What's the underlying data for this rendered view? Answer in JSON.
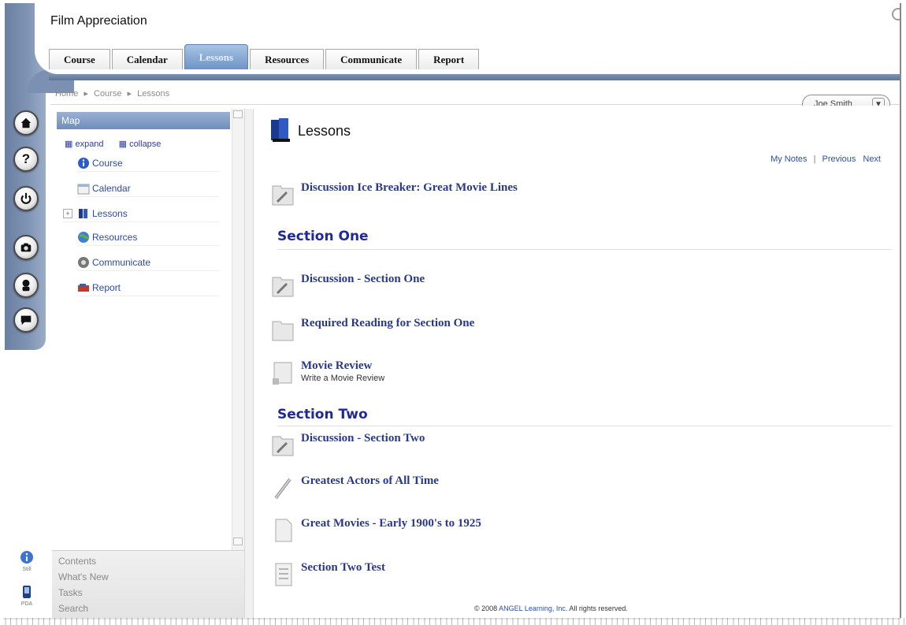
{
  "app": {
    "title": "Film Appreciation"
  },
  "tabs": [
    {
      "label": "Course",
      "active": false
    },
    {
      "label": "Calendar",
      "active": false
    },
    {
      "label": "Lessons",
      "active": true
    },
    {
      "label": "Resources",
      "active": false
    },
    {
      "label": "Communicate",
      "active": false
    },
    {
      "label": "Report",
      "active": false
    }
  ],
  "breadcrumb": [
    "Home",
    "Course",
    "Lessons"
  ],
  "breadcrumb_separator": "▸",
  "user_menu": {
    "label": "Joe Smith",
    "arrow": "▼"
  },
  "rail_icons": [
    "home-icon",
    "help-icon",
    "power-icon",
    "camera-icon",
    "profile-icon",
    "chat-icon"
  ],
  "rail_glyphs": {
    "help": "?"
  },
  "map": {
    "header": "Map",
    "expand": "expand",
    "collapse": "collapse",
    "items": [
      {
        "label": "Course",
        "icon": "info-icon"
      },
      {
        "label": "Calendar",
        "icon": "calendar-icon"
      },
      {
        "label": "Lessons",
        "icon": "book-icon",
        "toggle": "+"
      },
      {
        "label": "Resources",
        "icon": "globe-icon"
      },
      {
        "label": "Communicate",
        "icon": "communicate-icon"
      },
      {
        "label": "Report",
        "icon": "report-icon"
      }
    ]
  },
  "bottom_nav": [
    "Contents",
    "What's New",
    "Tasks",
    "Search"
  ],
  "mini_icons": [
    {
      "label": "Still",
      "icon": "info-icon"
    },
    {
      "label": "PDA",
      "icon": "pda-icon"
    }
  ],
  "main": {
    "title": "Lessons",
    "links": {
      "notes": "My Notes",
      "separator": "|",
      "previous": "Previous",
      "next": "Next"
    },
    "items": [
      {
        "label": "Discussion Ice Breaker: Great Movie Lines",
        "icon": "discussion-icon"
      },
      {
        "label": "Discussion - Section One",
        "icon": "discussion-icon"
      },
      {
        "label": "Required Reading for Section One",
        "icon": "folder-icon"
      },
      {
        "label": "Movie Review",
        "desc": "Write a Movie Review",
        "icon": "assignment-icon"
      },
      {
        "label": "Discussion - Section Two",
        "icon": "discussion-icon"
      },
      {
        "label": "Greatest Actors of All Time",
        "icon": "pencil-icon"
      },
      {
        "label": "Great Movies - Early 1900's to 1925",
        "icon": "document-icon"
      },
      {
        "label": "Section Two Test",
        "icon": "test-icon"
      }
    ],
    "sections": [
      "Section One",
      "Section Two"
    ],
    "footer": {
      "prefix": "© 2008",
      "company": "ANGEL Learning, Inc.",
      "suffix": "All rights reserved."
    }
  },
  "colors": {
    "accent": "#6f8dbb",
    "link": "#2a4aa8",
    "item_title": "#28378f",
    "section": "#1f2a96"
  }
}
